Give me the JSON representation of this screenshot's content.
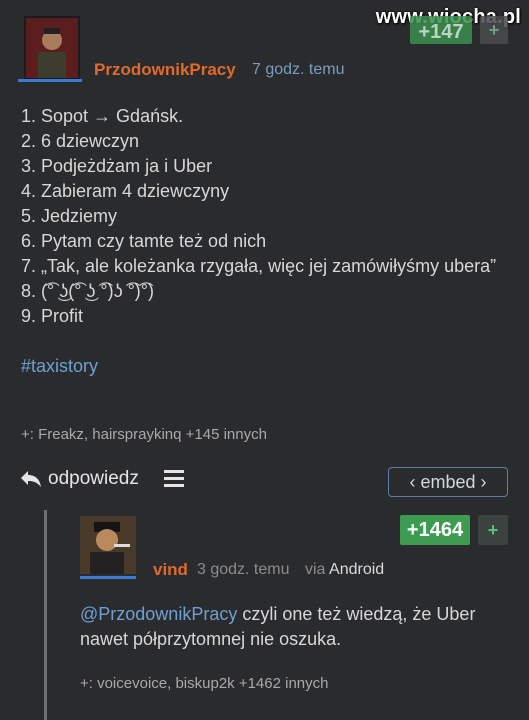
{
  "watermark": "www.wiocha.pl",
  "post": {
    "votes": "+147",
    "plus": "+",
    "author": "PrzodownikPracy",
    "time": "7 godz. temu",
    "lines": [
      "1. Sopot → Gdańsk.",
      "2. 6 dziewczyn",
      "3. Podjeżdżam ja i Uber",
      "4. Zabieram 4 dziewczyny",
      "5. Jedziemy",
      "6. Pytam czy tamte też od nich",
      "7. „Tak, ale koleżanka rzygała, więc jej zamówiłyśmy ubera”",
      "8. (͡° ͜ʖ(͡° ͜ʖ ͡°)ʖ ͡°)͡°)",
      "9. Profit"
    ],
    "hashtag": "#taxistory",
    "likers": "+: Freakz, hairspraykinq +145 innych",
    "reply_label": "odpowiedz",
    "embed_label": "‹ embed ›"
  },
  "reply": {
    "votes": "+1464",
    "plus": "+",
    "author": "vind",
    "time": "3 godz. temu",
    "via_prefix": "via",
    "via_app": "Android",
    "mention": "@PrzodownikPracy",
    "text": " czyli one też wiedzą, że Uber nawet półprzytomnej nie oszuka.",
    "likers": "+: voicevoice, biskup2k +1462 innych"
  }
}
